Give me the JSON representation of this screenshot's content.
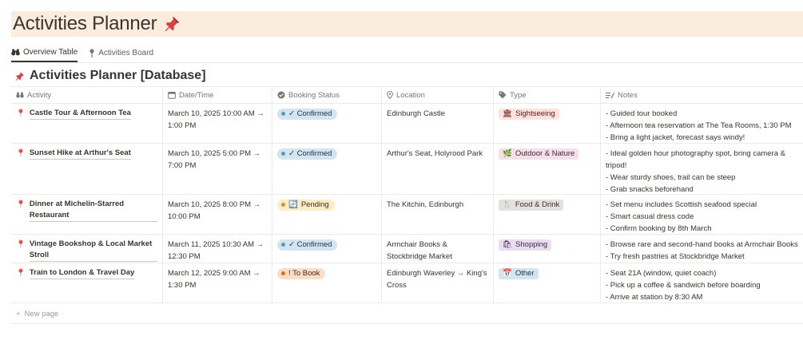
{
  "page": {
    "title": "Activities Planner"
  },
  "tabs": [
    {
      "label": "Overview Table",
      "icon": "binoculars-icon",
      "active": true
    },
    {
      "label": "Activities Board",
      "icon": "pin-icon",
      "active": false
    }
  ],
  "database": {
    "title": "Activities Planner [Database]"
  },
  "columns": {
    "activity": "Activity",
    "datetime": "Date/Time",
    "booking": "Booking Status",
    "location": "Location",
    "type": "Type",
    "notes": "Notes"
  },
  "rows": [
    {
      "activity": "Castle Tour & Afternoon Tea",
      "datetime": "March 10, 2025 10:00 AM → 1:00 PM",
      "status": "✓ Confirmed",
      "location": "Edinburgh Castle",
      "type": "Sightseeing",
      "notes": [
        "- Guided tour booked",
        "- Afternoon tea reservation at The Tea Rooms, 1:30 PM",
        "- Bring a light jacket, forecast says windy!"
      ]
    },
    {
      "activity": "Sunset Hike at Arthur's Seat",
      "datetime": "March 10, 2025 5:00 PM → 7:00 PM",
      "status": "✓ Confirmed",
      "location": "Arthur's Seat, Holyrood Park",
      "type": "Outdoor & Nature",
      "notes": [
        "- Ideal golden hour photography spot, bring camera & tripod!",
        "- Wear sturdy shoes, trail can be steep",
        "- Grab snacks beforehand"
      ]
    },
    {
      "activity": "Dinner at Michelin-Starred Restaurant",
      "datetime": "March 10, 2025 8:00 PM → 10:00 PM",
      "status": "Pending",
      "location": "The Kitchin, Edinburgh",
      "type": "Food & Drink",
      "notes": [
        "- Set menu includes Scottish seafood special",
        "- Smart casual dress code",
        "- Confirm booking by 8th March"
      ]
    },
    {
      "activity": "Vintage Bookshop & Local Market Stroll",
      "datetime": "March 11, 2025 10:30 AM → 12:30 PM",
      "status": "✓ Confirmed",
      "location": "Armchair Books & Stockbridge Market",
      "type": "Shopping",
      "notes": [
        "- Browse rare and second-hand books at Armchair Books",
        "- Try fresh pastries at Stockbridge Market"
      ]
    },
    {
      "activity": "Train to London & Travel Day",
      "datetime": "March 12, 2025 9:00 AM → 1:30 PM",
      "status": "! To Book",
      "location": "Edinburgh Waverley → King's Cross",
      "type": "Other",
      "notes": [
        "- Seat 21A (window, quiet coach)",
        "- Pick up a coffee & sandwich before boarding",
        "- Arrive at station by 8:30 AM"
      ]
    }
  ],
  "new_page": "New page",
  "colors": {
    "title_bg": "#fbecdd",
    "confirmed": "#d3e5ef",
    "pending": "#fdecc8",
    "to_book": "#fadec9"
  }
}
